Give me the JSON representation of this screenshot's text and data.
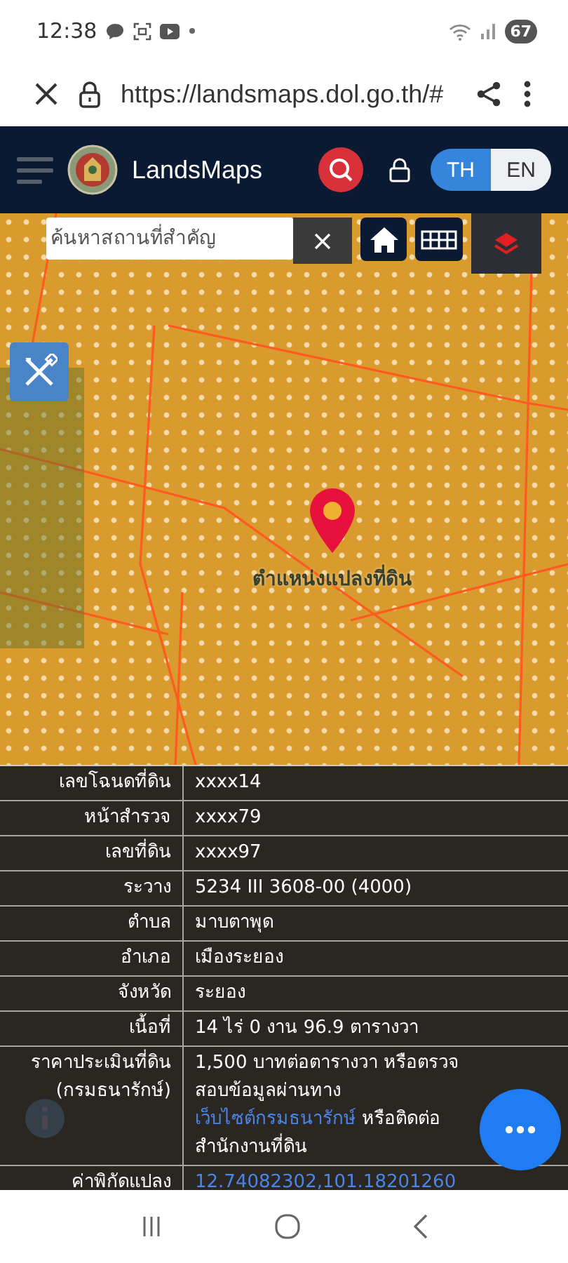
{
  "status_bar": {
    "time": "12:38",
    "battery": "67"
  },
  "browser": {
    "url": "https://landsmaps.dol.go.th/#"
  },
  "header": {
    "title": "LandsMaps",
    "languages": [
      {
        "label": "TH",
        "selected": true
      },
      {
        "label": "EN",
        "selected": false
      }
    ]
  },
  "map": {
    "search": {
      "placeholder": "ค้นหาสถานที่สำคัญ"
    },
    "marker_label": "ตำแหน่งแปลงที่ดิน"
  },
  "parcel_table": [
    {
      "label": "เลขโฉนดที่ดิน",
      "parts": [
        {
          "text": "xxxx14",
          "link": false
        }
      ]
    },
    {
      "label": "หน้าสำรวจ",
      "parts": [
        {
          "text": "xxxx79",
          "link": false
        }
      ]
    },
    {
      "label": "เลขที่ดิน",
      "parts": [
        {
          "text": "xxxx97",
          "link": false
        }
      ]
    },
    {
      "label": "ระวาง",
      "parts": [
        {
          "text": "5234 III 3608-00 (4000)",
          "link": false
        }
      ]
    },
    {
      "label": "ตำบล",
      "parts": [
        {
          "text": "มาบตาพุด",
          "link": false
        }
      ]
    },
    {
      "label": "อำเภอ",
      "parts": [
        {
          "text": "เมืองระยอง",
          "link": false
        }
      ]
    },
    {
      "label": "จังหวัด",
      "parts": [
        {
          "text": "ระยอง",
          "link": false
        }
      ]
    },
    {
      "label": "เนื้อที่",
      "parts": [
        {
          "text": "14 ไร่ 0 งาน 96.9 ตารางวา",
          "link": false
        }
      ]
    },
    {
      "label": "ราคาประเมินที่ดิน (กรมธนารักษ์)",
      "parts": [
        {
          "text": "1,500 บาทต่อตารางวา หรือตรวจสอบข้อมูลผ่านทาง ",
          "link": false
        },
        {
          "text": "เว็บไซต์กรมธนารักษ์",
          "link": true
        },
        {
          "text": " หรือติดต่อสำนักงานที่ดิน",
          "link": false
        }
      ]
    },
    {
      "label": "ค่าพิกัดแปลง",
      "parts": [
        {
          "text": "12.74082302,101.18201260",
          "link": true
        }
      ]
    }
  ]
}
